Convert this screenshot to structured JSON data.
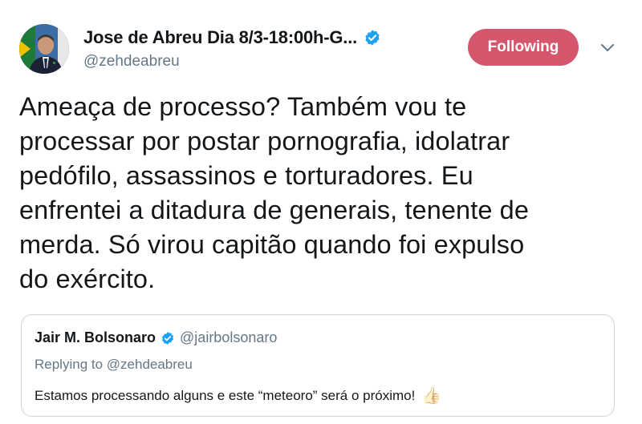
{
  "author": {
    "display_name": "Jose de Abreu Dia 8/3-18:00h-G...",
    "handle": "@zehdeabreu",
    "verified": true,
    "avatar": "avatar-photo"
  },
  "follow_button": {
    "label": "Following",
    "color": "#d4576e"
  },
  "more_menu": {
    "icon": "chevron-down-icon"
  },
  "tweet": {
    "lines": [
      "Ameaça de processo? Também vou te",
      "processar por postar pornografia, idolatrar",
      "pedófilo, assassinos e torturadores. Eu",
      "enfrentei a ditadura de generais, tenente de",
      "merda. Só virou capitão quando foi expulso",
      "do exército."
    ]
  },
  "quoted_tweet": {
    "display_name": "Jair M. Bolsonaro",
    "handle": "@jairbolsonaro",
    "verified": true,
    "replying_to": "Replying to @zehdeabreu",
    "text": "Estamos processando alguns e este “meteoro” será o próximo!",
    "emoji": "👍🏻"
  },
  "colors": {
    "verified_blue": "#1da1f2",
    "secondary_text": "#657786",
    "primary_text": "#14171a",
    "border": "#ccd6dd"
  }
}
